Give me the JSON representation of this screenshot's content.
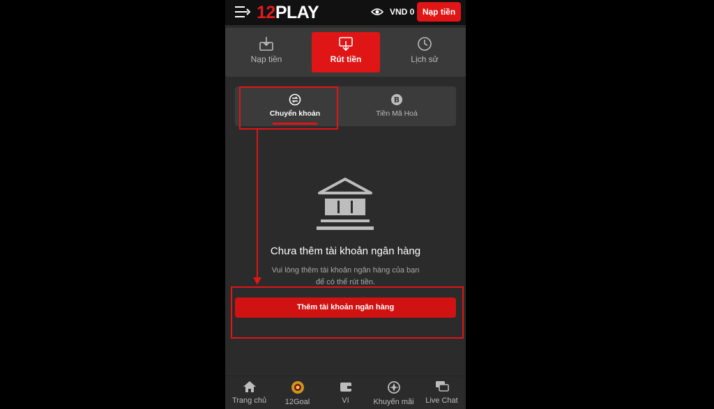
{
  "header": {
    "menu_icon": "hamburger-arrow-icon",
    "logo_number": "12",
    "logo_text": "PLAY",
    "balance": "VND 0",
    "deposit_label": "Nạp tiền"
  },
  "tabs": [
    {
      "label": "Nạp tiền",
      "icon": "deposit-icon",
      "active": false
    },
    {
      "label": "Rút tiền",
      "icon": "withdraw-icon",
      "active": true
    },
    {
      "label": "Lịch sử",
      "icon": "clock-icon",
      "active": false
    }
  ],
  "subtabs": [
    {
      "label": "Chuyển khoản",
      "icon": "transfer-icon",
      "active": true
    },
    {
      "label": "Tiền Mã Hoá",
      "icon": "bitcoin-icon",
      "active": false
    }
  ],
  "empty_state": {
    "icon": "bank-icon",
    "title": "Chưa thêm tài khoản ngân hàng",
    "description": "Vui lòng thêm tài khoản ngân hàng của bạn để có thể rút tiền."
  },
  "add_button_label": "Thêm tài khoản ngân hàng",
  "bottom_nav": [
    {
      "label": "Trang chủ",
      "icon": "home-icon"
    },
    {
      "label": "12Goal",
      "icon": "12goal-icon"
    },
    {
      "label": "Ví",
      "icon": "wallet-icon"
    },
    {
      "label": "Khuyến mãi",
      "icon": "promotion-icon"
    },
    {
      "label": "Live Chat",
      "icon": "chat-icon"
    }
  ],
  "colors": {
    "accent": "#e01515",
    "background": "#2b2b2b",
    "topbar": "#111111"
  }
}
